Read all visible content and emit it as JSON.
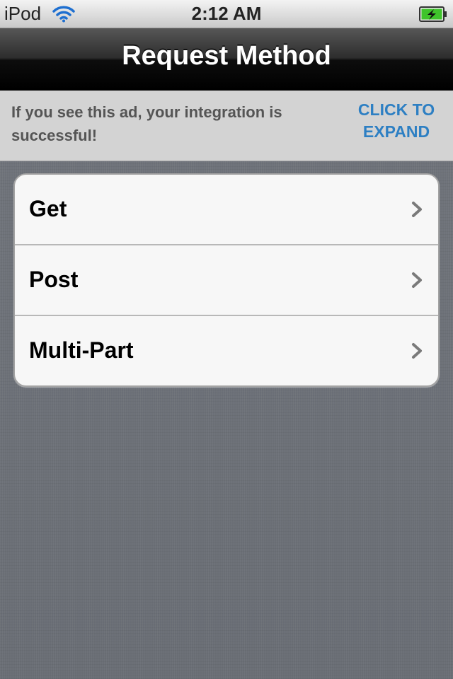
{
  "status_bar": {
    "carrier": "iPod",
    "time": "2:12 AM",
    "icons": [
      "wifi-icon",
      "battery-charging-icon"
    ]
  },
  "nav_bar": {
    "title": "Request Method"
  },
  "ad_banner": {
    "message": "If you see this ad, your integration is successful!",
    "cta": "CLICK TO EXPAND",
    "cta_color": "#2d7fc3"
  },
  "table": {
    "rows": [
      {
        "label": "Get",
        "accessory": "chevron-right-icon"
      },
      {
        "label": "Post",
        "accessory": "chevron-right-icon"
      },
      {
        "label": "Multi-Part",
        "accessory": "chevron-right-icon"
      }
    ]
  },
  "colors": {
    "battery_fill": "#3fc42b",
    "nav_bar": "#000000",
    "background": "#6c7078"
  }
}
